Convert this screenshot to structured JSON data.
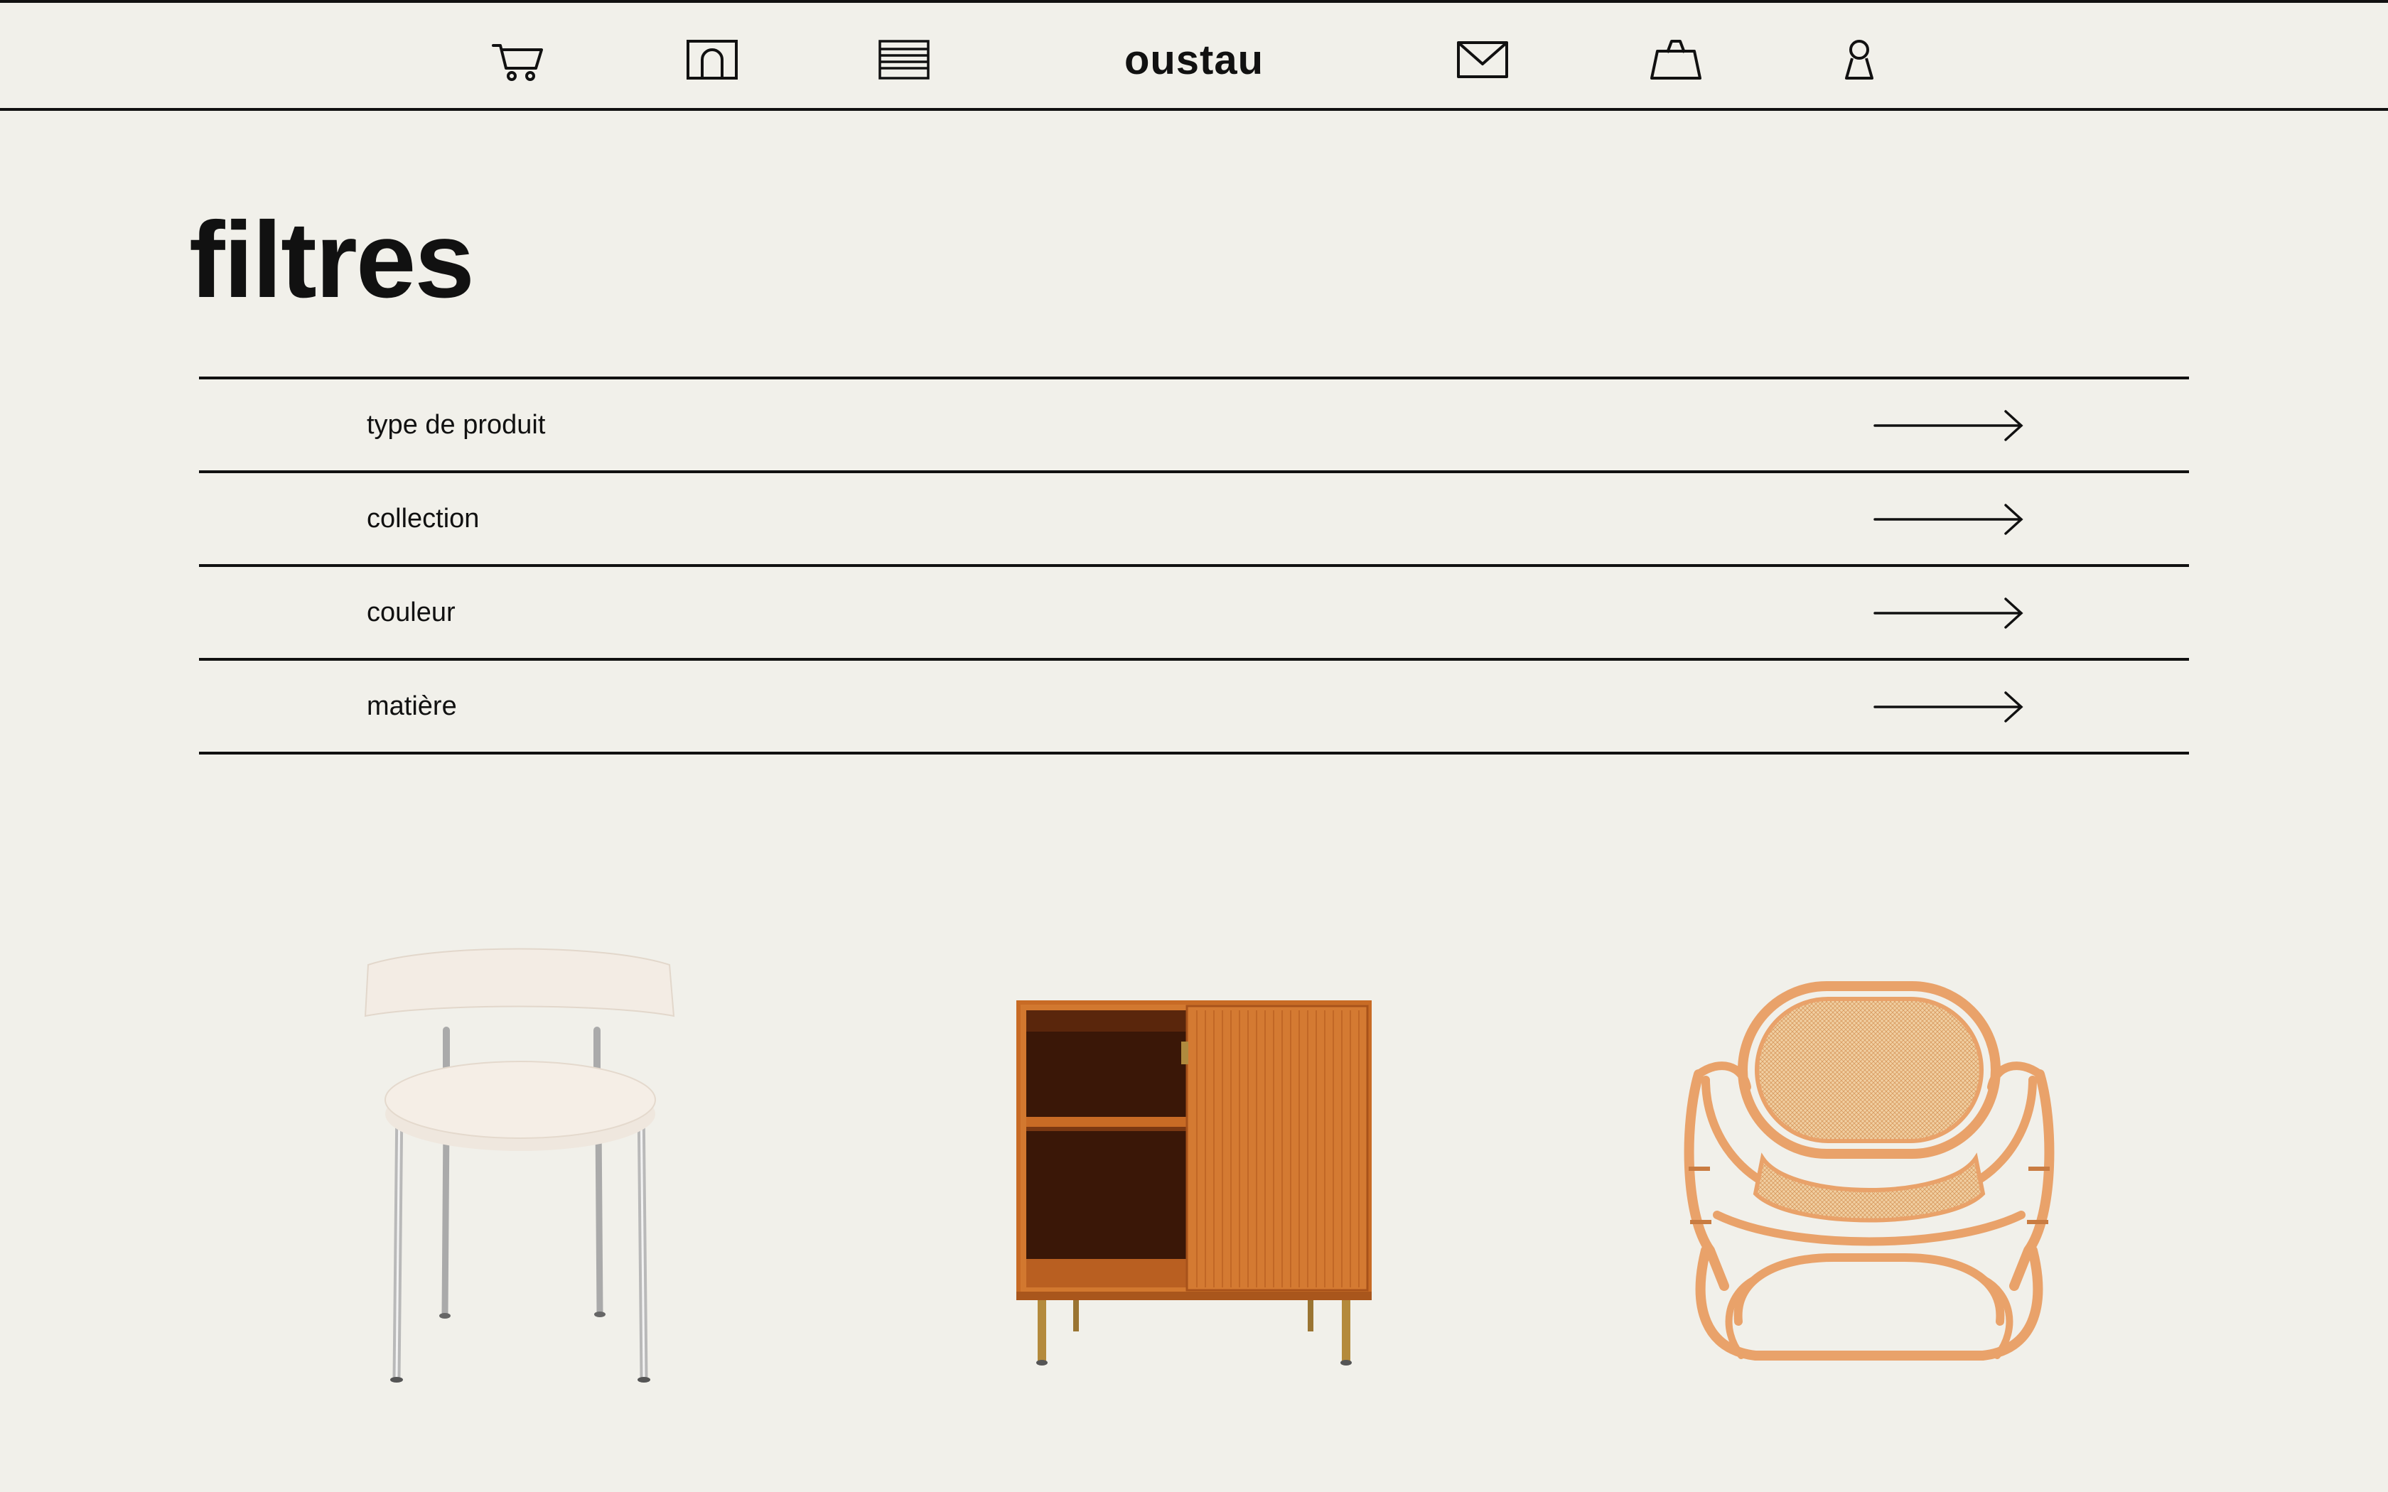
{
  "header": {
    "brand": "oustau",
    "icons": [
      "cart-icon",
      "arch-icon",
      "menu-lines-icon",
      "mail-icon",
      "bag-icon",
      "user-icon"
    ]
  },
  "page": {
    "title": "filtres"
  },
  "filters": [
    {
      "label": "type de produit",
      "icon": "arrow-right-icon"
    },
    {
      "label": "collection",
      "icon": "arrow-right-icon"
    },
    {
      "label": "couleur",
      "icon": "arrow-right-icon"
    },
    {
      "label": "matière",
      "icon": "arrow-right-icon"
    }
  ],
  "products": [
    {
      "image": "boucle-chair-image"
    },
    {
      "image": "wooden-cabinet-image"
    },
    {
      "image": "rattan-armchair-image"
    }
  ],
  "colors": {
    "background": "#f1f0ea",
    "ink": "#111111",
    "wood": "#c86b25",
    "rattan": "#e8a66e",
    "boucle": "#f3ece4"
  }
}
